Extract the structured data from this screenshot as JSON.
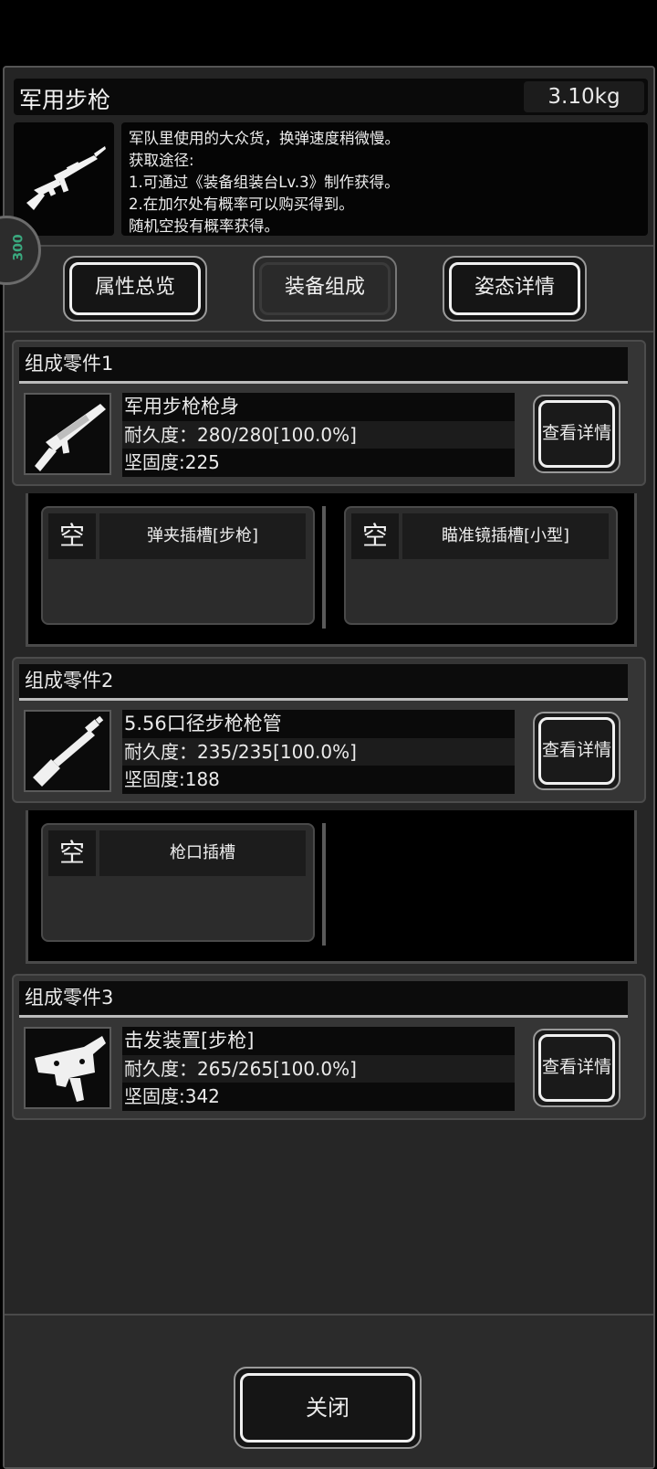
{
  "item": {
    "name": "军用步枪",
    "weight": "3.10kg",
    "icon": "rifle-icon",
    "description": [
      "军队里使用的大众货，换弹速度稍微慢。",
      "获取途径:",
      "1.可通过《装备组装台Lv.3》制作获得。",
      "2.在加尔处有概率可以购买得到。",
      "随机空投有概率获得。"
    ]
  },
  "tabs": [
    {
      "label": "属性总览",
      "active": false
    },
    {
      "label": "装备组成",
      "active": true
    },
    {
      "label": "姿态详情",
      "active": false
    }
  ],
  "parts": [
    {
      "header": "组成零件1",
      "name": "军用步枪枪身",
      "durability": "耐久度：280/280[100.0%]",
      "hardness": "坚固度:225",
      "icon": "rifle-body-icon",
      "detail_label": "查看详情",
      "slots": [
        {
          "empty_label": "空",
          "name": "弹夹插槽[步枪]"
        },
        {
          "empty_label": "空",
          "name": "瞄准镜插槽[小型]"
        }
      ]
    },
    {
      "header": "组成零件2",
      "name": "5.56口径步枪枪管",
      "durability": "耐久度：235/235[100.0%]",
      "hardness": "坚固度:188",
      "icon": "barrel-icon",
      "detail_label": "查看详情",
      "slots": [
        {
          "empty_label": "空",
          "name": "枪口插槽"
        }
      ]
    },
    {
      "header": "组成零件3",
      "name": "击发装置[步枪]",
      "durability": "耐久度：265/265[100.0%]",
      "hardness": "坚固度:342",
      "icon": "trigger-mechanism-icon",
      "detail_label": "查看详情",
      "slots": []
    }
  ],
  "close_label": "关闭"
}
